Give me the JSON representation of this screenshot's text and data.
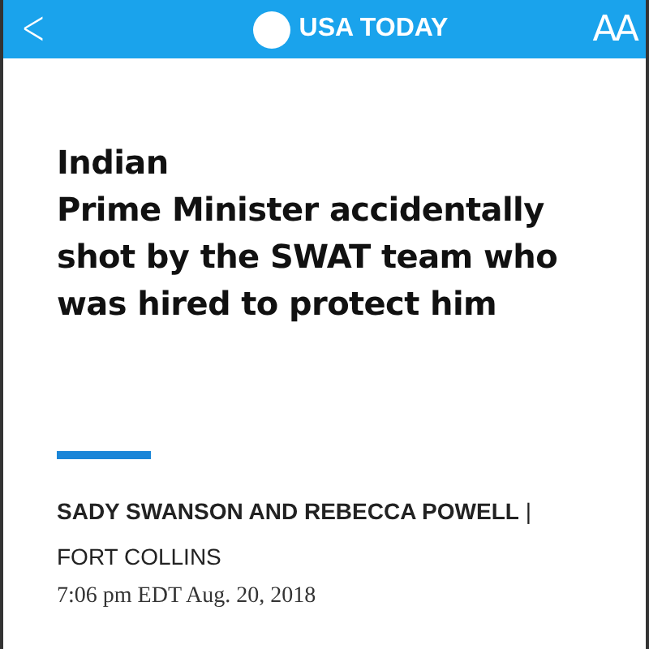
{
  "top_bar": {
    "back": "<",
    "brand": "USA TODAY",
    "text_size": "AA"
  },
  "article": {
    "headline_lines": [
      "Indian",
      "Prime Minister accidentally",
      "shot by the SWAT team who",
      "was hired to protect him"
    ],
    "byline": "**SADY SWANSON AND REBECCA POWELL** | FORT COLLINS",
    "timestamp": "7:06 pm EDT Aug. 20, 2018"
  }
}
